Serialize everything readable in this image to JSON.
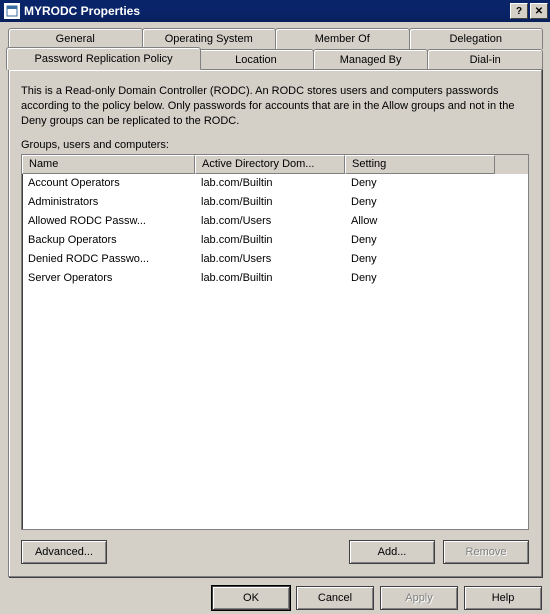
{
  "titlebar": {
    "title": "MYRODC Properties"
  },
  "tabs": {
    "row1": [
      "General",
      "Operating System",
      "Member Of",
      "Delegation"
    ],
    "row2": [
      "Password Replication Policy",
      "Location",
      "Managed By",
      "Dial-in"
    ],
    "active": "Password Replication Policy"
  },
  "panel": {
    "description": "This is a Read-only Domain Controller (RODC).  An RODC stores users and computers passwords according to the policy below.  Only passwords for accounts that are in the Allow groups and not in the Deny groups can be replicated to the RODC.",
    "list_label": "Groups, users and computers:",
    "columns": [
      "Name",
      "Active Directory Dom...",
      "Setting"
    ],
    "rows": [
      {
        "name": "Account Operators",
        "domain": "lab.com/Builtin",
        "setting": "Deny"
      },
      {
        "name": "Administrators",
        "domain": "lab.com/Builtin",
        "setting": "Deny"
      },
      {
        "name": "Allowed RODC Passw...",
        "domain": "lab.com/Users",
        "setting": "Allow"
      },
      {
        "name": "Backup Operators",
        "domain": "lab.com/Builtin",
        "setting": "Deny"
      },
      {
        "name": "Denied RODC Passwo...",
        "domain": "lab.com/Users",
        "setting": "Deny"
      },
      {
        "name": "Server Operators",
        "domain": "lab.com/Builtin",
        "setting": "Deny"
      }
    ],
    "buttons": {
      "advanced": "Advanced...",
      "add": "Add...",
      "remove": "Remove"
    }
  },
  "dialog_buttons": {
    "ok": "OK",
    "cancel": "Cancel",
    "apply": "Apply",
    "help": "Help"
  }
}
